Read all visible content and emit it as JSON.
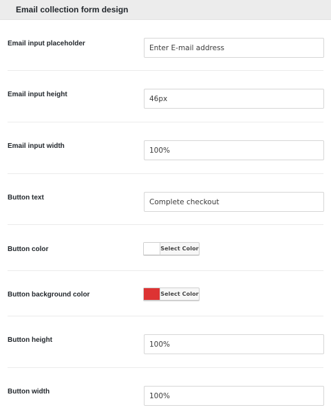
{
  "section": {
    "title": "Email collection form design"
  },
  "fields": {
    "email_placeholder": {
      "label": "Email input placeholder",
      "value": "Enter E-mail address"
    },
    "email_height": {
      "label": "Email input height",
      "value": "46px"
    },
    "email_width": {
      "label": "Email input width",
      "value": "100%"
    },
    "button_text": {
      "label": "Button text",
      "value": "Complete checkout"
    },
    "button_color": {
      "label": "Button color",
      "picker_label": "Select Color",
      "color": "#ffffff"
    },
    "button_bg_color": {
      "label": "Button background color",
      "picker_label": "Select Color",
      "color": "#dd3333"
    },
    "button_height": {
      "label": "Button height",
      "value": "100%"
    },
    "button_width": {
      "label": "Button width",
      "value": "100%"
    }
  }
}
